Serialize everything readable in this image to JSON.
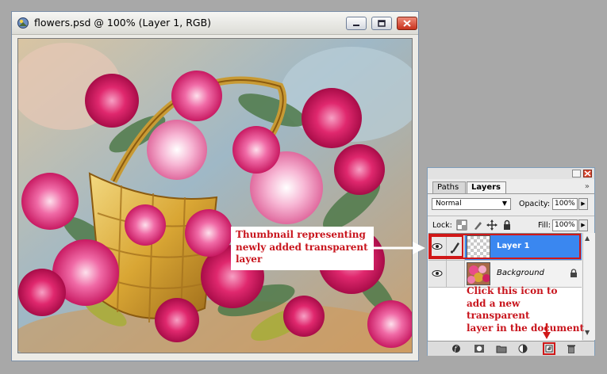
{
  "document_window": {
    "title": "flowers.psd @ 100% (Layer 1, RGB)",
    "buttons": [
      "minimize",
      "maximize",
      "close"
    ]
  },
  "layers_palette": {
    "tabs": [
      {
        "label": "Paths",
        "active": false
      },
      {
        "label": "Layers",
        "active": true
      }
    ],
    "blend_mode": "Normal",
    "opacity_label": "Opacity:",
    "opacity_value": "100%",
    "lock_label": "Lock:",
    "fill_label": "Fill:",
    "fill_value": "100%",
    "layers": [
      {
        "name": "Layer 1",
        "selected": true,
        "thumbnail": "transparent"
      },
      {
        "name": "Background",
        "selected": false,
        "thumbnail": "flowers",
        "locked": true
      }
    ]
  },
  "annotations": {
    "callout_lines": [
      "Thumbnail representing",
      "newly added transparent",
      "layer"
    ],
    "instruction_lines": [
      "Click this icon to",
      "add a new transparent",
      "layer in the document"
    ]
  },
  "colors": {
    "highlight_red": "#d01818",
    "annotation_text": "#c8141c",
    "selected_layer": "#3a87f0"
  }
}
